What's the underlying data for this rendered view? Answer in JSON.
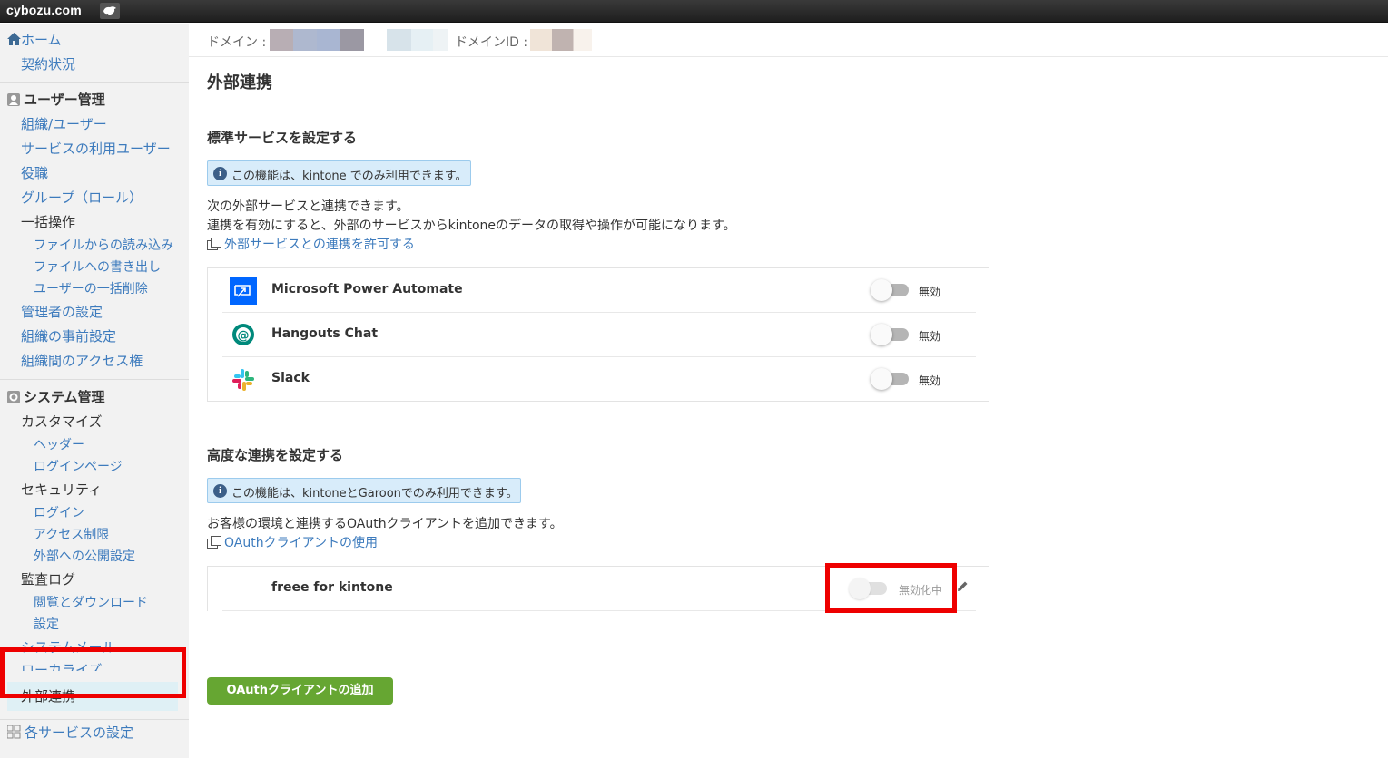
{
  "topbar": {
    "logo_text": "cybozu.com",
    "logo_icon": "cybozu-logo-icon"
  },
  "sidebar": {
    "home": "ホーム",
    "contract": "契約状況",
    "user_mgmt_head": "ユーザー管理",
    "org_users": "組織/ユーザー",
    "service_users": "サービスの利用ユーザー",
    "positions": "役職",
    "groups": "グループ（ロール）",
    "bulk": "一括操作",
    "bulk_import": "ファイルからの読み込み",
    "bulk_export": "ファイルへの書き出し",
    "bulk_delete": "ユーザーの一括削除",
    "admins": "管理者の設定",
    "org_pre": "組織の事前設定",
    "org_access": "組織間のアクセス権",
    "system_head": "システム管理",
    "customize": "カスタマイズ",
    "header": "ヘッダー",
    "login_page": "ログインページ",
    "security": "セキュリティ",
    "login": "ログイン",
    "access_limit": "アクセス制限",
    "external_publish": "外部への公開設定",
    "audit_log": "監査ログ",
    "audit_view": "閲覧とダウンロード",
    "audit_settings": "設定",
    "system_mail": "システムメール",
    "localize": "ローカライズ",
    "external_link": "外部連携",
    "services_settings": "各サービスの設定"
  },
  "domain_bar": {
    "domain_label": "ドメイン :",
    "domain_id_label": "ドメインID :"
  },
  "main": {
    "title": "外部連携",
    "standard": {
      "heading": "標準サービスを設定する",
      "info": "この機能は、kintone でのみ利用できます。",
      "desc1": "次の外部サービスと連携できます。",
      "desc2": "連携を有効にすると、外部のサービスからkintoneのデータの取得や操作が可能になります。",
      "link": "外部サービスとの連携を許可する",
      "services": [
        {
          "name": "Microsoft Power Automate",
          "status": "無効",
          "enabled": false
        },
        {
          "name": "Hangouts Chat",
          "status": "無効",
          "enabled": false
        },
        {
          "name": "Slack",
          "status": "無効",
          "enabled": false
        }
      ]
    },
    "advanced": {
      "heading": "高度な連携を設定する",
      "info": "この機能は、kintoneとGaroonでのみ利用できます。",
      "desc": "お客様の環境と連携するOAuthクライアントを追加できます。",
      "link": "OAuthクライアントの使用",
      "clients": [
        {
          "name": "freee for kintone",
          "status": "無効化中",
          "enabled": false
        }
      ],
      "add_button": "OAuthクライアントの追加"
    }
  },
  "colors": {
    "link": "#3d7bbd",
    "accent_green": "#66a632",
    "highlight_red": "#e00000",
    "info_bg": "#d8ecfa"
  }
}
